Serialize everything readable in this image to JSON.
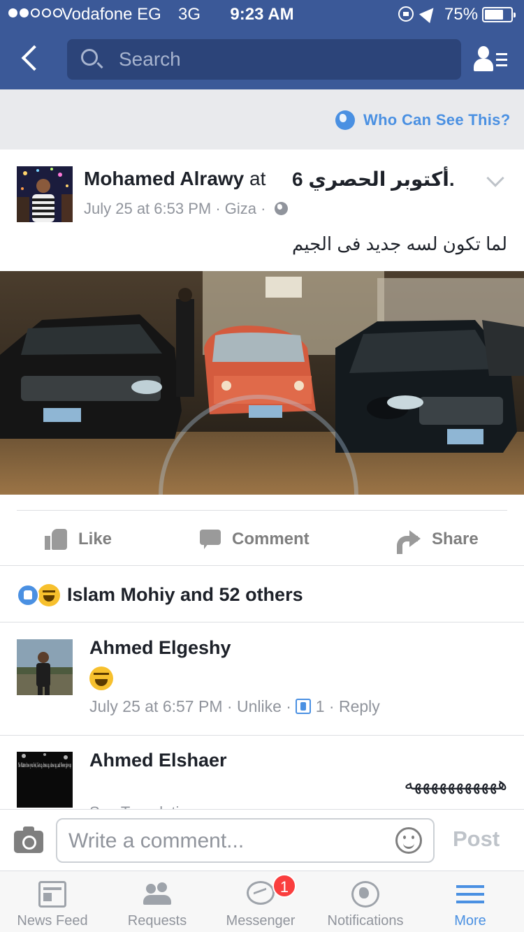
{
  "status_bar": {
    "carrier": "Vodafone EG",
    "network": "3G",
    "time": "9:23 AM",
    "battery": "75%",
    "battery_level": 0.75
  },
  "nav": {
    "search_placeholder": "Search"
  },
  "privacy": {
    "label": "Who Can See This?"
  },
  "post": {
    "author": "Mohamed Alrawy",
    "at_word": "at",
    "place": "أكتوبر الحصري 6.",
    "date": "July 25 at 6:53 PM",
    "location": "Giza",
    "text": "لما تكون لسه جديد فى الجيم",
    "actions": {
      "like": "Like",
      "comment": "Comment",
      "share": "Share"
    },
    "reactions_text": "Islam Mohiy and 52 others"
  },
  "comments": [
    {
      "name": "Ahmed Elgeshy",
      "time": "July 25 at 6:57 PM",
      "unlike": "Unlike",
      "like_count": "1",
      "reply": "Reply"
    },
    {
      "name": "Ahmed Elshaer",
      "text": "هههههههههههه",
      "see_translation": "See Translation",
      "avatar_text": "No Matter how you feel, Get up, dress up, show up, and Never give up"
    }
  ],
  "composer": {
    "placeholder": "Write a comment...",
    "post_label": "Post"
  },
  "tabbar": {
    "items": [
      {
        "label": "News Feed"
      },
      {
        "label": "Requests"
      },
      {
        "label": "Messenger",
        "badge": "1"
      },
      {
        "label": "Notifications"
      },
      {
        "label": "More"
      }
    ]
  },
  "colors": {
    "brand": "#3b5998",
    "link": "#4a90e2",
    "badge": "#fa3e3e"
  }
}
